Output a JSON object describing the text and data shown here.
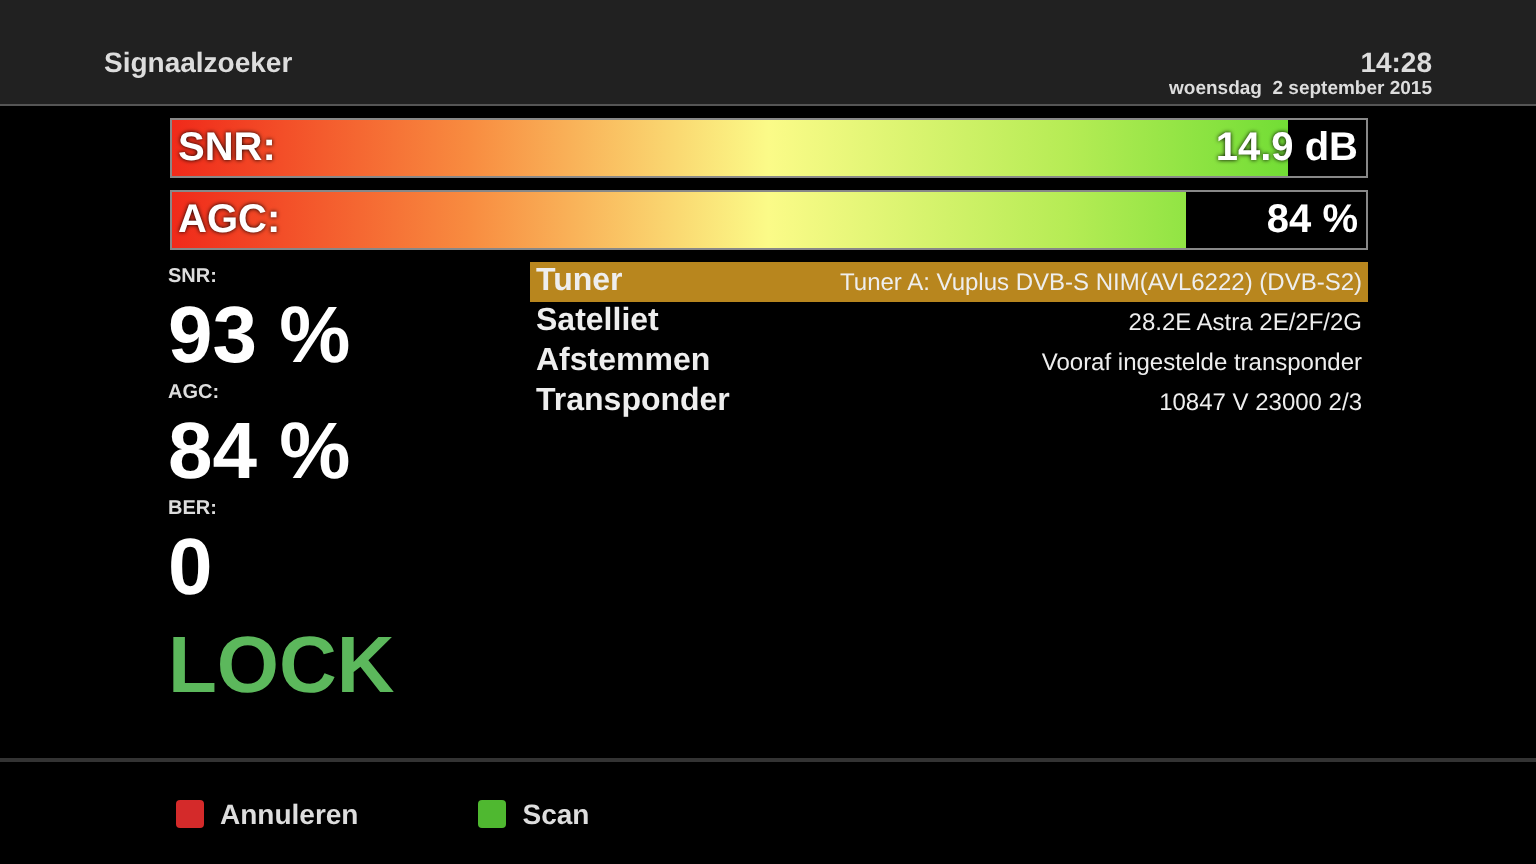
{
  "header": {
    "title": "Signaalzoeker",
    "time": "14:28",
    "date": "woensdag  2 september 2015"
  },
  "bars": [
    {
      "label": "SNR:",
      "reading": "14.9 dB",
      "level": 0.935
    },
    {
      "label": "AGC:",
      "reading": "84 %",
      "level": 0.85
    }
  ],
  "stats": [
    {
      "label": "SNR:",
      "value": "93 %",
      "kind": "value"
    },
    {
      "label": "AGC:",
      "value": "84 %",
      "kind": "value"
    },
    {
      "label": "BER:",
      "value": "0",
      "kind": "value"
    },
    {
      "value": "LOCK",
      "kind": "lock"
    }
  ],
  "info": [
    {
      "label": "Tuner",
      "value": "Tuner A: Vuplus DVB-S NIM(AVL6222) (DVB-S2)",
      "selected": true
    },
    {
      "label": "Satelliet",
      "value": "28.2E Astra 2E/2F/2G",
      "selected": false
    },
    {
      "label": "Afstemmen",
      "value": "Vooraf ingestelde transponder",
      "selected": false
    },
    {
      "label": "Transponder",
      "value": "10847 V 23000 2/3",
      "selected": false
    }
  ],
  "buttons": [
    {
      "label": "Annuleren",
      "color": "#d42a2a"
    },
    {
      "label": "Scan",
      "color": "#4fb830"
    }
  ]
}
